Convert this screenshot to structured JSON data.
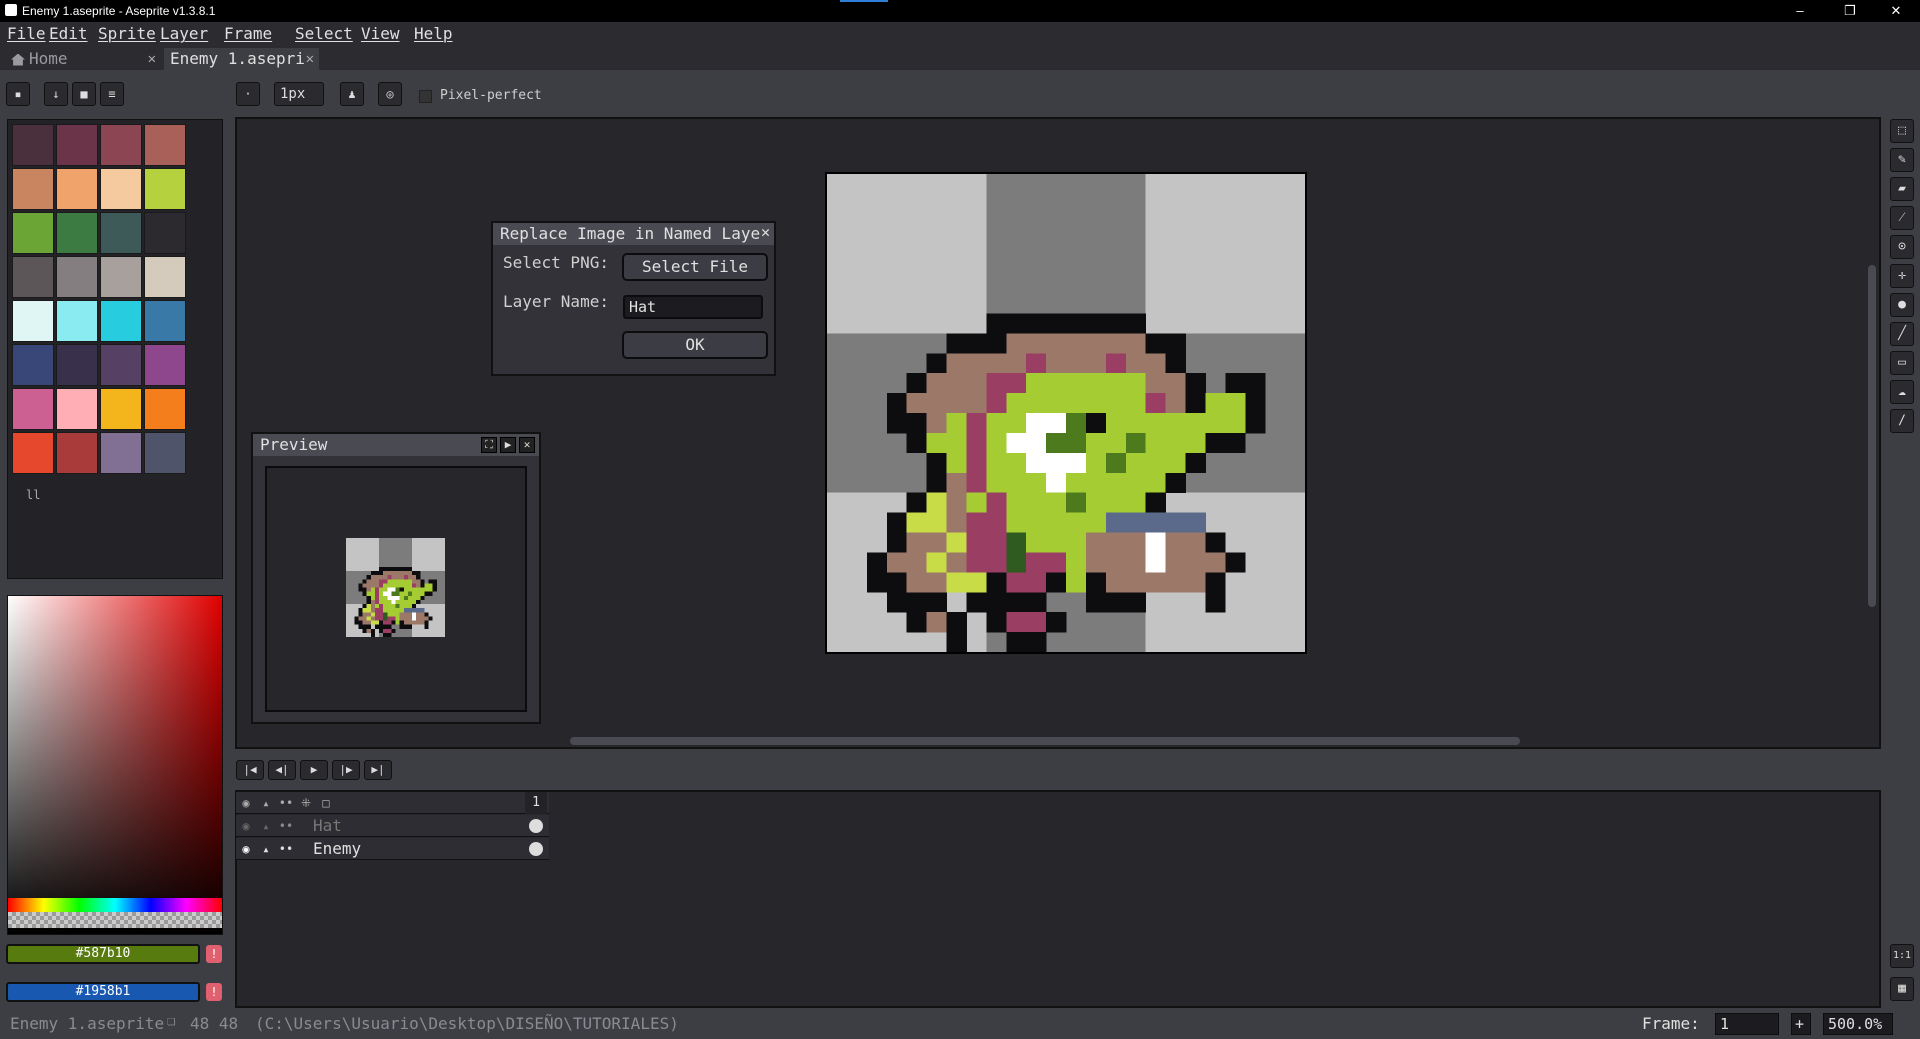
{
  "window": {
    "title": "Enemy 1.aseprite - Aseprite v1.3.8.1",
    "minimize": "–",
    "restore": "❐",
    "close": "✕"
  },
  "menu": [
    "File",
    "Edit",
    "Sprite",
    "Layer",
    "Frame",
    "Select",
    "View",
    "Help"
  ],
  "tabs": [
    {
      "label": "Home",
      "close": "✕"
    },
    {
      "label": "Enemy 1.asepri",
      "close": "✕"
    }
  ],
  "toolbar": {
    "brush_size": "1px",
    "pixel_perfect_label": "Pixel-perfect",
    "pixel_perfect_checked": false
  },
  "palette": {
    "colors": [
      "#4a2f3c",
      "#6b3449",
      "#8c4552",
      "#a86058",
      "#c98460",
      "#f0a46c",
      "#f5ca9e",
      "#b5d13e",
      "#6aa535",
      "#3c7c43",
      "#3d5a58",
      "#2c2a2e",
      "#5c5658",
      "#847e80",
      "#a8a09c",
      "#d5cbbc",
      "#dff6f5",
      "#8aebf1",
      "#28ccdf",
      "#3979a8",
      "#394778",
      "#39314b",
      "#564064",
      "#8e478c",
      "#cd6093",
      "#ffaeb6",
      "#f4b41b",
      "#f47e1b",
      "#e6482e",
      "#a93b3b",
      "#827094",
      "#4f546b"
    ],
    "mode_glyph": "ll"
  },
  "colors": {
    "foreground": "#587b10",
    "background": "#1958b1",
    "fg_label": "#587b10",
    "bg_label": "#1958b1",
    "warn_glyph": "!"
  },
  "dialog": {
    "title": "Replace Image in Named Laye",
    "select_png_label": "Select PNG:",
    "select_file_button": "Select File",
    "layer_name_label": "Layer Name:",
    "layer_name_value": "Hat",
    "ok_button": "OK",
    "close": "✕"
  },
  "preview": {
    "title": "Preview"
  },
  "timeline": {
    "frame_header": "1",
    "layers": [
      {
        "name": "Hat",
        "visible": false
      },
      {
        "name": "Enemy",
        "visible": true
      }
    ]
  },
  "status": {
    "filename": "Enemy 1.aseprite",
    "size": "48 48",
    "path": "(C:\\Users\\Usuario\\Desktop\\DISEÑO\\TUTORIALES)",
    "frame_label": "Frame:",
    "frame_value": "1",
    "add_frame": "+",
    "zoom": "500.0%"
  },
  "right_tools": [
    "marquee-icon",
    "pencil-icon",
    "eraser-icon",
    "eyedropper-icon",
    "zoom-icon",
    "move-icon",
    "fill-icon",
    "line-icon",
    "rectangle-icon",
    "blur-icon",
    "spray-icon"
  ],
  "sprite": {
    "grid": [
      "......................",
      ".......########.......",
      ".....###bbbbbbb##.....",
      "....#bbbbpbbbpbb#.....",
      "...#bbbppggggggbb#.##.",
      "..#bbbbpgggggggpb#gg#.",
      "..##bgpggwwk#ggggggg#.",
      "...#ggpgwwkkggkggg##..",
      "....#gpggwwwgkggg#....",
      "....#bpgggwggggg#.....",
      "...#ybgpgggkggg#......",
      "..#yybppgggggsssss....",
      "..#bbyppdgggbbbwbb#...",
      ".#bbybppdppgbbbwbbb#..",
      ".##bbyy#pp#g#bbbbb#...",
      "..###.####..###...#...",
      "...#b#.#pp#...........",
      ".....#..##............"
    ],
    "palette_key": {
      "#": "#0d0d10",
      "b": "#9c7868",
      "p": "#9a3f63",
      "g": "#a6cc34",
      "w": "#ffffff",
      "k": "#4e7a1e",
      "y": "#c8dc48",
      "s": "#5b6a8a",
      "d": "#2f5a20"
    }
  }
}
